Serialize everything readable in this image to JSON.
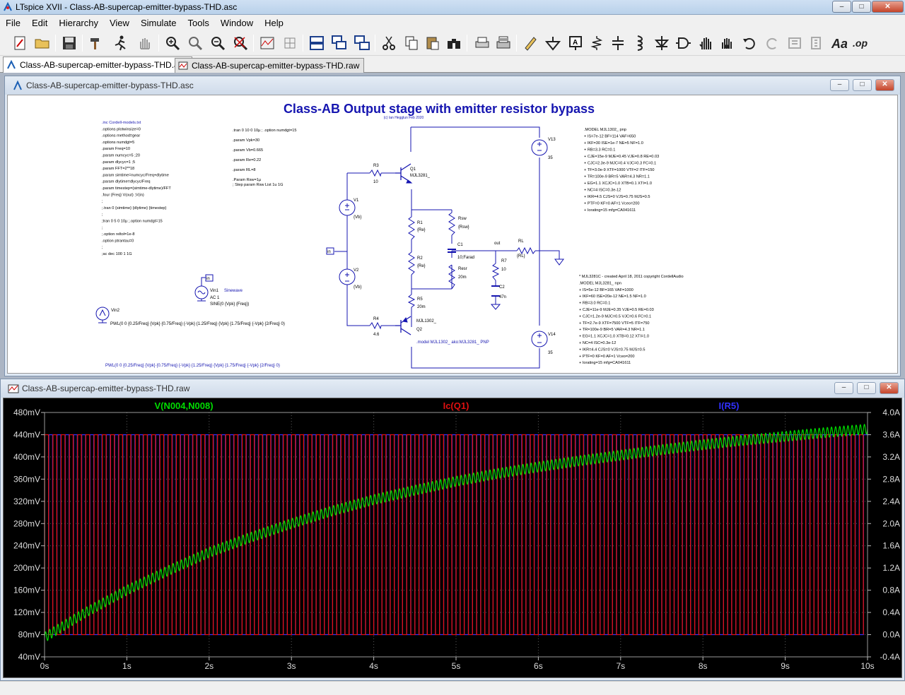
{
  "window": {
    "title": "LTspice XVII - Class-AB-supercap-emitter-bypass-THD.asc",
    "minimize": "‒",
    "maximize": "□",
    "close": "✕"
  },
  "menu": [
    "File",
    "Edit",
    "Hierarchy",
    "View",
    "Simulate",
    "Tools",
    "Window",
    "Help"
  ],
  "tabs": [
    {
      "label": "Class-AB-supercap-emitter-bypass-THD.asc",
      "icon": "schematic-icon",
      "active": true
    },
    {
      "label": "Class-AB-supercap-emitter-bypass-THD.raw",
      "icon": "waveform-icon",
      "active": false
    }
  ],
  "schematic_window": {
    "title": "Class-AB-supercap-emitter-bypass-THD.asc",
    "heading": "Class-AB Output stage with emitter resistor bypass",
    "byline": "(c) Ian Hegglun Feb 2020",
    "directives_left": [
      ".inc Cordell-models.txt",
      ".options plotwinsize=0",
      ".options method=gear",
      ".options numdgt=5",
      ".param Freq=10",
      ".param numcyc=5 ;20",
      ".param dlycyc=1 ;5",
      ".param FFT=2**18",
      ".param simtime=numcyc/Freq+dlytime",
      ".param dlytime=dlycyc/Freq",
      ".param timestep=(simtime-dlytime)/FFT",
      ".four {Freq} V(out) ;V(in)",
      ";",
      ";.tran 0 {simtime} {dlytime} {timestep}",
      ";",
      ";tran 0 5 0 10µ ;.option numdgt=15",
      ";",
      ";.option reltol=1e-8",
      ".option ptrantau=0",
      ";",
      ";ac dec 100 1 1G"
    ],
    "directives_mid": [
      ".tran 0 10 0 10µ ; .option numdgt=15",
      "",
      ".param Vpk=30",
      "",
      ".param Vb=0.665",
      "",
      ".param Re=0.22",
      "",
      ".param RL=8",
      "",
      ".Param Rsw=1µ",
      "; Step param Rsw List 1u 1G"
    ],
    "model_pnp": [
      ".MODEL MJL1302_ pnp",
      "+        IS=7e-12     BF=114              VAF=650",
      "+        IKF=30           ISE=1e-7     NE=5              NF=1.0",
      "+        RB=3.3              RC=0.1",
      "+        CJE=15e-9     MJE=0.45    VJE=0.8            RE=0.03",
      "+        CJC=2.3e-9    MJC=0.4           VJC=0.3            FC=0.1",
      "+        TF=3.0e-9     XTF=1000     VTF=2           ITF=150",
      "+        TR=100e-9     BR=5               VAR=4.3     NR=1.1",
      "+        EG=1.1          XCJC=1.0    XTB=0.1        XTI=1.0",
      "+        NC=4               ISC=0.3e-12",
      "+        IKR=4.5             CJS=0                VJS=0.75      MJS=0.5",
      "+        PTF=0              KF=0                AF=1              Vceo=200",
      "+        Iorating=15    mfg=CA041611"
    ],
    "model_npn": [
      "* MJL3281C - created April 18, 2011 copyright CordellAudio",
      ".MODEL MJL3281_ npn",
      "+        IS=5e-12     BF=165              VAF=1000",
      "+        IKF=60           ISE=20e-12   NE=1.5              NF=1.0",
      "+        RB=3.0              RC=0.1",
      "+        CJE=11e-9     MJE=0.35    VJE=0.5            RE=0.03",
      "+        CJC=1.2e-9    MJC=0.5           VJC=0.6            FC=0.1",
      "+        TF=2.7e-9     XTF=7500     VTF=5           ITF=750",
      "+        TR=100e-9     BR=5               VAR=4.3     NR=1.1",
      "+        EG=1.1          XCJC=1.0    XTB=0.12      XTI=1.0",
      "+        NC=4               ISC=0.3e-12",
      "+        IKR=4.4             CJS=0                VJS=0.75      MJS=0.5",
      "+        PTF=0              KF=0                AF=1              Vceo=200",
      "+        Iorating=15    mfg=CA041611"
    ],
    "components": {
      "Q1": "Q1",
      "Q1_model": "MJL3281_",
      "Q2": "Q2",
      "Q2_model": "MJL1302_",
      "R3": "R3",
      "R3_val": "10",
      "R4": "R4",
      "R4_val": "4.6",
      "R1": "R1",
      "R1_val": "{Re}",
      "R2": "R2",
      "R2_val": "{Re}",
      "R5": "R5",
      "R5_val": "20m",
      "Rsw": "Rsw",
      "Rsw_val": "{Rsw}",
      "Resr": "Resr",
      "Resr_val": "20m",
      "C1": "C1",
      "C1_val": "10;Farad",
      "R7": "R7",
      "R7_val": "10",
      "C2": "C2",
      "C2_val": "47n",
      "RL": "RL",
      "RL_val": "{RL}",
      "V1": "V1",
      "V1_val": "{Vb}",
      "V2": "V2",
      "V2_val": "{Vb}",
      "V13": "V13",
      "V13_val": "35",
      "V14": "V14",
      "V14_val": "35",
      "Vin1": "Vin1",
      "Vin1_note": "Sinewave",
      "Vin1_ac": "AC 1",
      "Vin1_sine": "SINE(0 {Vpk} {Freq})",
      "Vin2": "Vin2",
      "Vin2_pwl": "PWL(0 0 {0.25/Freq} {Vpk} {0.75/Freq} {-Vpk} {1.25/Freq} {Vpk} {1.75/Freq} {-Vpk} {2/Freq} 0)",
      "pwl_bottom": "PWL(0 0 {0.25/Freq} {Vpk} {0.75/Freq} {-Vpk} {1.25/Freq} {Vpk} {1.75/Freq} {-Vpk} {2/Freq} 0)",
      "in_label": "in",
      "in_label2": "in",
      "out_label": "out",
      "model_alias": ".model MJL1302_ ako:MJL3281_ PNP"
    }
  },
  "plot_window": {
    "title": "Class-AB-supercap-emitter-bypass-THD.raw",
    "traces": [
      {
        "name": "V(N004,N008)",
        "color": "#00dd00"
      },
      {
        "name": "Ic(Q1)",
        "color": "#e01010"
      },
      {
        "name": "I(R5)",
        "color": "#3030ff"
      }
    ],
    "chart_data": {
      "type": "line",
      "xlabel": "",
      "xlim": [
        0,
        10
      ],
      "x_ticks": [
        "0s",
        "1s",
        "2s",
        "3s",
        "4s",
        "5s",
        "6s",
        "7s",
        "8s",
        "9s",
        "10s"
      ],
      "left_axis": {
        "ylim": [
          40,
          480
        ],
        "ticks": [
          "40mV",
          "80mV",
          "120mV",
          "160mV",
          "200mV",
          "240mV",
          "280mV",
          "320mV",
          "360mV",
          "400mV",
          "440mV",
          "480mV"
        ]
      },
      "right_axis": {
        "ylim": [
          -0.4,
          4.0
        ],
        "ticks": [
          "-0.4A",
          "0.0A",
          "0.4A",
          "0.8A",
          "1.2A",
          "1.6A",
          "2.0A",
          "2.4A",
          "2.8A",
          "3.2A",
          "3.6A",
          "4.0A"
        ]
      },
      "grid": true,
      "series": [
        {
          "name": "V(N004,N008)",
          "axis": "left",
          "x": [
            0,
            0.5,
            1,
            1.5,
            2,
            2.5,
            3,
            3.5,
            4,
            4.5,
            5,
            5.5,
            6,
            6.5,
            7,
            7.5,
            8,
            8.5,
            9,
            9.5,
            10
          ],
          "y": [
            75,
            120,
            160,
            195,
            228,
            255,
            280,
            303,
            323,
            340,
            356,
            370,
            382,
            393,
            403,
            413,
            422,
            430,
            437,
            444,
            450
          ],
          "ripple_mV": 18
        },
        {
          "name": "Ic(Q1)",
          "axis": "right",
          "frequency_hz": 10,
          "min": 0.0,
          "max": 3.6
        },
        {
          "name": "I(R5)",
          "axis": "right",
          "frequency_hz": 10,
          "min": 0.0,
          "max": 3.6
        }
      ]
    }
  }
}
